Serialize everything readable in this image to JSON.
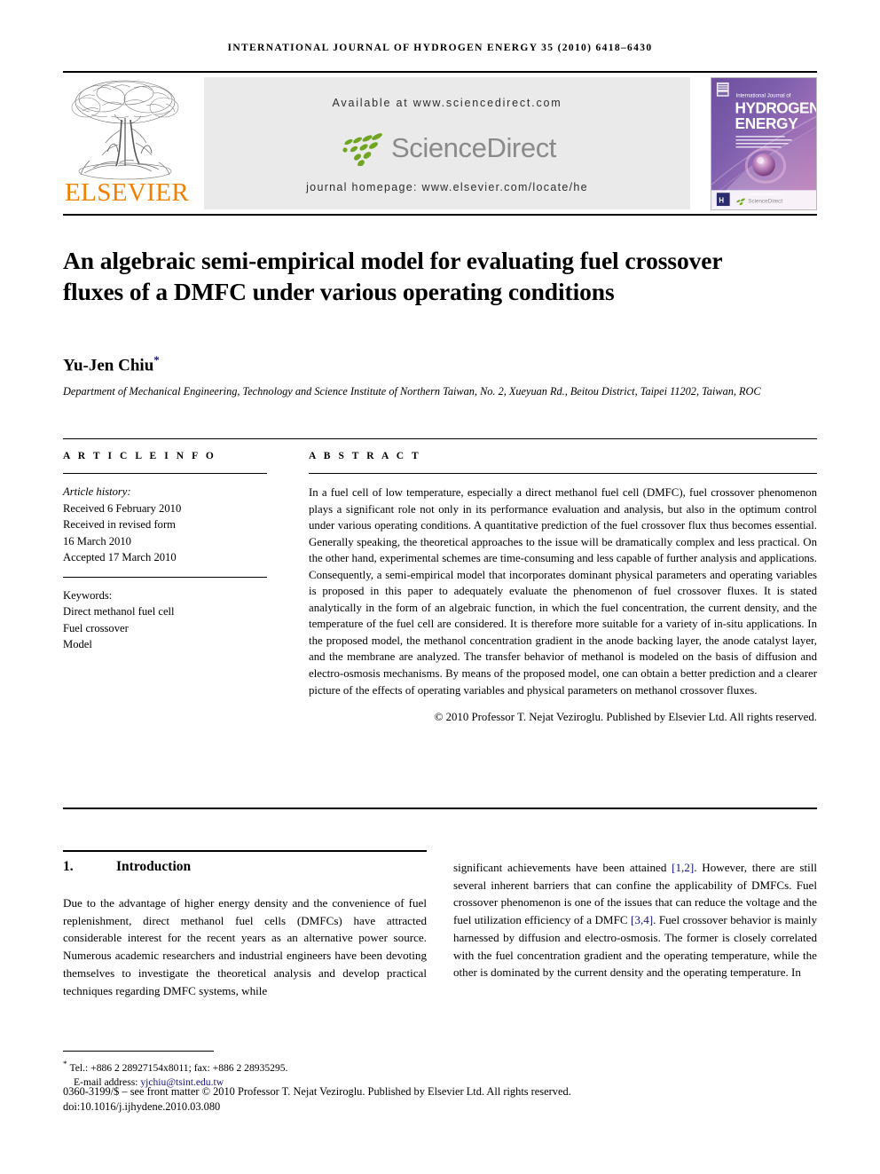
{
  "running_head": "International Journal of Hydrogen Energy 35 (2010) 6418–6430",
  "masthead": {
    "publisher_name": "ELSEVIER",
    "available_at": "Available at www.sciencedirect.com",
    "sciencedirect_label": "ScienceDirect",
    "journal_homepage": "journal homepage: www.elsevier.com/locate/he",
    "cover": {
      "line1": "International Journal of",
      "line2": "HYDROGEN",
      "line3": "ENERGY",
      "editor_block": "Editor-in-Chief: T. Nejat Veziroglu   Associate Editors: D. Hissel, A.A. Kornyshev, R.A. Smith, A.T. Stamatios, I.A. Stanford, C.L. Cruse and E.A. Veziroglu",
      "footer_label": "ScienceDirect"
    }
  },
  "title": "An algebraic semi-empirical model for evaluating fuel crossover fluxes of a DMFC under various operating conditions",
  "author": {
    "name": "Yu-Jen Chiu",
    "corresponding_marker": "*"
  },
  "affiliation": "Department of Mechanical Engineering, Technology and Science Institute of Northern Taiwan, No. 2, Xueyuan Rd., Beitou District, Taipei 11202, Taiwan, ROC",
  "article_info": {
    "heading": "A R T I C L E   I N F O",
    "history_label": "Article history:",
    "history": [
      "Received 6 February 2010",
      "Received in revised form",
      "16 March 2010",
      "Accepted 17 March 2010"
    ],
    "keywords_label": "Keywords:",
    "keywords": [
      "Direct methanol fuel cell",
      "Fuel crossover",
      "Model"
    ]
  },
  "abstract": {
    "heading": "A B S T R A C T",
    "text": "In a fuel cell of low temperature, especially a direct methanol fuel cell (DMFC), fuel crossover phenomenon plays a significant role not only in its performance evaluation and analysis, but also in the optimum control under various operating conditions. A quantitative prediction of the fuel crossover flux thus becomes essential. Generally speaking, the theoretical approaches to the issue will be dramatically complex and less practical. On the other hand, experimental schemes are time-consuming and less capable of further analysis and applications. Consequently, a semi-empirical model that incorporates dominant physical parameters and operating variables is proposed in this paper to adequately evaluate the phenomenon of fuel crossover fluxes. It is stated analytically in the form of an algebraic function, in which the fuel concentration, the current density, and the temperature of the fuel cell are considered. It is therefore more suitable for a variety of in-situ applications. In the proposed model, the methanol concentration gradient in the anode backing layer, the anode catalyst layer, and the membrane are analyzed. The transfer behavior of methanol is modeled on the basis of diffusion and electro-osmosis mechanisms. By means of the proposed model, one can obtain a better prediction and a clearer picture of the effects of operating variables and physical parameters on methanol crossover fluxes.",
    "copyright": "© 2010 Professor T. Nejat Veziroglu. Published by Elsevier Ltd. All rights reserved."
  },
  "body": {
    "section_number": "1.",
    "section_title": "Introduction",
    "left_paragraph": "Due to the advantage of higher energy density and the convenience of fuel replenishment, direct methanol fuel cells (DMFCs) have attracted considerable interest for the recent years as an alternative power source. Numerous academic researchers and industrial engineers have been devoting themselves to investigate the theoretical analysis and develop practical techniques regarding DMFC systems, while",
    "right_parts": {
      "p1": "significant achievements have been attained ",
      "cite1": "[1,2]",
      "p2": ". However, there are still several inherent barriers that can confine the applicability of DMFCs. Fuel crossover phenomenon is one of the issues that can reduce the voltage and the fuel utilization efficiency of a DMFC ",
      "cite2": "[3,4]",
      "p3": ". Fuel crossover behavior is mainly harnessed by diffusion and electro-osmosis. The former is closely correlated with the fuel concentration gradient and the operating temperature, while the other is dominated by the current density and the operating temperature. In"
    }
  },
  "footnote": {
    "tel_line": "Tel.: +886 2 28927154x8011; fax: +886 2 28935295.",
    "email_label": "E-mail address: ",
    "email": "yjchiu@tsint.edu.tw"
  },
  "front_matter": {
    "line1": "0360-3199/$ – see front matter © 2010 Professor T. Nejat Veziroglu. Published by Elsevier Ltd. All rights reserved.",
    "line2": "doi:10.1016/j.ijhydene.2010.03.080"
  },
  "colors": {
    "elsevier_orange": "#F08000",
    "sciencedirect_green": "#6FA520",
    "sciencedirect_gray": "#8a8a8a",
    "link_blue": "#14147a",
    "banner_gray": "#EAEAEA"
  }
}
